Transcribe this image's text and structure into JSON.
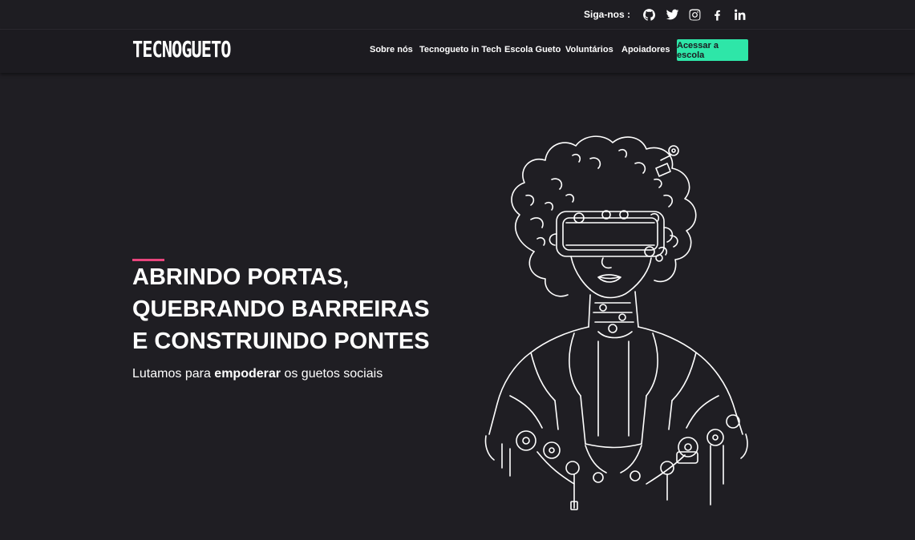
{
  "topbar": {
    "follow_label": "Siga-nos :",
    "social": [
      {
        "icon": "github-icon"
      },
      {
        "icon": "twitter-icon"
      },
      {
        "icon": "instagram-icon"
      },
      {
        "icon": "facebook-icon"
      },
      {
        "icon": "linkedin-icon"
      }
    ]
  },
  "nav": {
    "logo": "TECNOGUETO",
    "links": [
      "Sobre nós",
      "Tecnogueto in Tech",
      "Escola Gueto",
      "Voluntários",
      "Apoiadores"
    ],
    "cta": "Acessar a escola"
  },
  "hero": {
    "headline": [
      "ABRINDO PORTAS,",
      "QUEBRANDO BARREIRAS",
      "E CONSTRUINDO PONTES"
    ],
    "sub_before": "Lutamos para",
    "sub_bold": "empoderar",
    "sub_after": "os guetos sociais"
  },
  "colors": {
    "background": "#1f1e23",
    "accent_pink": "#e8457d",
    "cta_green": "#2ee6a8"
  }
}
